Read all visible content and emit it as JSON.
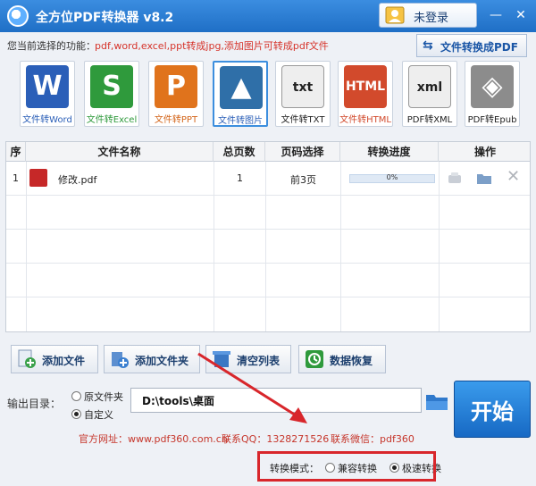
{
  "app": {
    "title": "全方位PDF转换器 v8.2",
    "login_label": "未登录"
  },
  "function_bar": {
    "label": "您当前选择的功能：",
    "desc": "pdf,word,excel,ppt转成jpg,添加图片可转成pdf文件",
    "to_pdf_button": "文件转换成PDF"
  },
  "tools": [
    {
      "label": "文件转Word",
      "glyph": "W",
      "color": "#2b5fb8",
      "cap_color": "#2b5fb8"
    },
    {
      "label": "文件转Excel",
      "glyph": "S",
      "color": "#2f9a3c",
      "cap_color": "#2f9a3c"
    },
    {
      "label": "文件转PPT",
      "glyph": "P",
      "color": "#e0731c",
      "cap_color": "#d3651a"
    },
    {
      "label": "文件转图片",
      "glyph": "▲",
      "color": "#2f6fa8",
      "cap_color": "#2b5fb8"
    },
    {
      "label": "文件转TXT",
      "glyph": "txt",
      "color": "#eeeeee",
      "cap_color": "#222222"
    },
    {
      "label": "文件转HTML",
      "glyph": "HTML",
      "color": "#d24a2c",
      "cap_color": "#d24a2c"
    },
    {
      "label": "PDF转XML",
      "glyph": "xml",
      "color": "#eeeeee",
      "cap_color": "#222222"
    },
    {
      "label": "PDF转Epub",
      "glyph": "◈",
      "color": "#8c8c8c",
      "cap_color": "#222222"
    }
  ],
  "table": {
    "headers": [
      "序",
      "文件名称",
      "总页数",
      "页码选择",
      "转换进度",
      "操作"
    ],
    "rows": [
      {
        "index": "1",
        "name": "修改.pdf",
        "pages": "1",
        "page_select": "前3页",
        "progress_text": "0%",
        "progress": 0
      }
    ]
  },
  "buttons": {
    "add_file": "添加文件",
    "add_folder": "添加文件夹",
    "clear_list": "清空列表",
    "data_recovery": "数据恢复",
    "start": "开始"
  },
  "output": {
    "label": "输出目录：",
    "opt_original": "原文件夹",
    "opt_custom": "自定义",
    "path": "D:\\tools\\桌面"
  },
  "footer": {
    "website": "官方网址：www.pdf360.com.cn",
    "qq": "联系QQ：1328271526",
    "wechat": "联系微信：pdf360"
  },
  "mode": {
    "label": "转换模式：",
    "compatible": "兼容转换",
    "fast": "极速转换"
  }
}
